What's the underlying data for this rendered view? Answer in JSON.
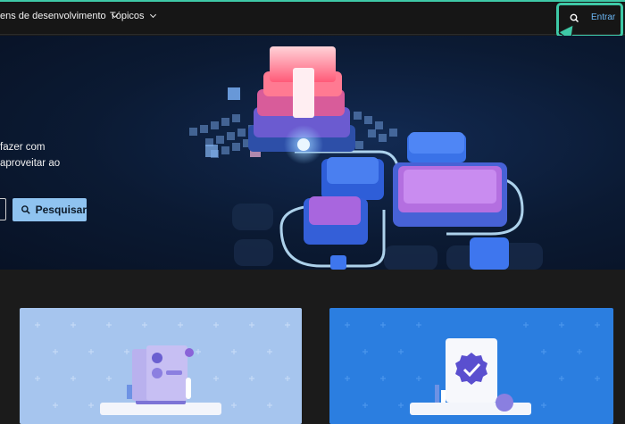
{
  "nav": {
    "items": [
      {
        "label": "ens de desenvolvimento"
      },
      {
        "label": "Tópicos"
      }
    ],
    "signin_label": "Entrar"
  },
  "hero": {
    "text_lines": [
      "fazer com",
      "aproveitar ao"
    ],
    "search_button_label": "Pesquisar"
  },
  "icons": {
    "search": "search-icon",
    "chevron": "chevron-down-icon",
    "cursor": "cursor-arrow-icon"
  },
  "colors": {
    "accent_highlight": "#3ec9a7",
    "link": "#6cb8f6",
    "search_button": "#8fc3f0",
    "card_1": "#a6c5ee",
    "card_2": "#2b7ee0"
  }
}
